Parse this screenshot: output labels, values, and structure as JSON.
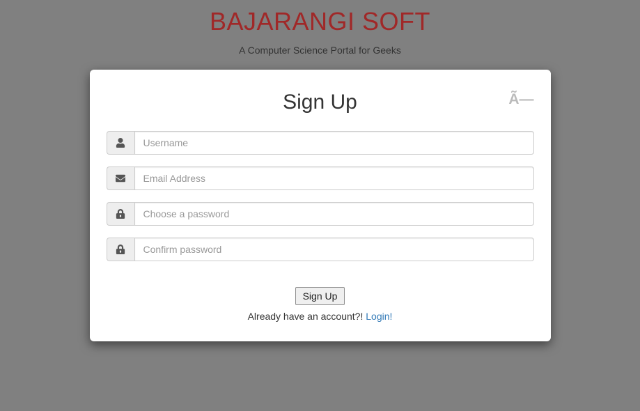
{
  "header": {
    "title": "BAJARANGI SOFT",
    "subtitle": "A Computer Science Portal for Geeks"
  },
  "modal": {
    "title": "Sign Up",
    "close_text": "Ã—",
    "fields": {
      "username": {
        "placeholder": "Username",
        "value": ""
      },
      "email": {
        "placeholder": "Email Address",
        "value": ""
      },
      "password": {
        "placeholder": "Choose a password",
        "value": ""
      },
      "confirm": {
        "placeholder": "Confirm password",
        "value": ""
      }
    },
    "submit_label": "Sign Up",
    "footer_text": "Already have an account?! ",
    "footer_link": "Login!"
  }
}
